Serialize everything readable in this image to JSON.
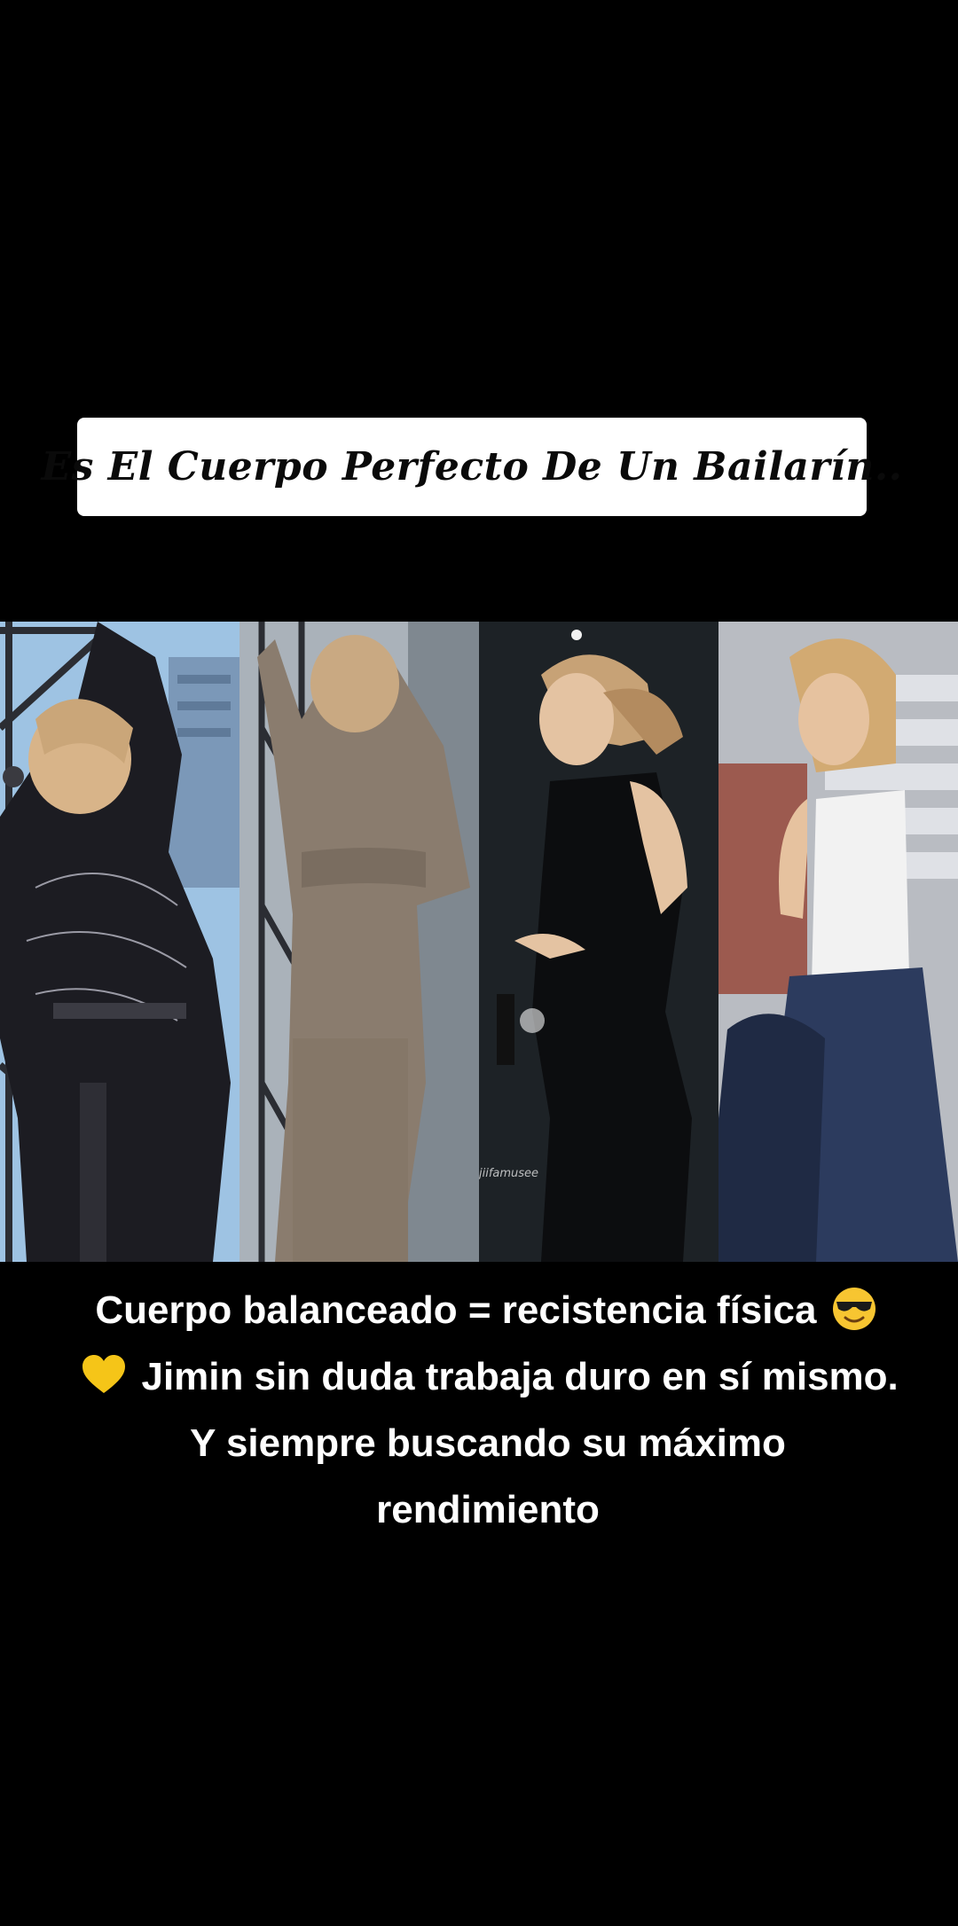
{
  "title": "Es El Cuerpo Perfecto De Un Bailarín..",
  "photos": [
    {
      "name": "photo-panel-1",
      "bg": "#9fc2e0",
      "accent": "#1b1b1f"
    },
    {
      "name": "photo-panel-2",
      "bg": "#a9b1b9",
      "accent": "#8a7b6c"
    },
    {
      "name": "photo-panel-3",
      "bg": "#1d2226",
      "accent": "#0c0d0f"
    },
    {
      "name": "photo-panel-4",
      "bg": "#b9bcc2",
      "accent": "#1f2a44"
    }
  ],
  "watermark": "jiifamusee",
  "caption": {
    "line1_text": "Cuerpo balanceado = recistencia física",
    "line1_icon": "sunglasses-face-icon",
    "line2_icon": "yellow-heart-icon",
    "line2_text": "Jimin sin duda trabaja duro en sí mismo.",
    "line3": "Y siempre buscando su máximo",
    "line4": "rendimiento"
  },
  "colors": {
    "background": "#000000",
    "title_box": "#ffffff",
    "title_text": "#0a0a0a",
    "caption_text": "#ffffff"
  }
}
